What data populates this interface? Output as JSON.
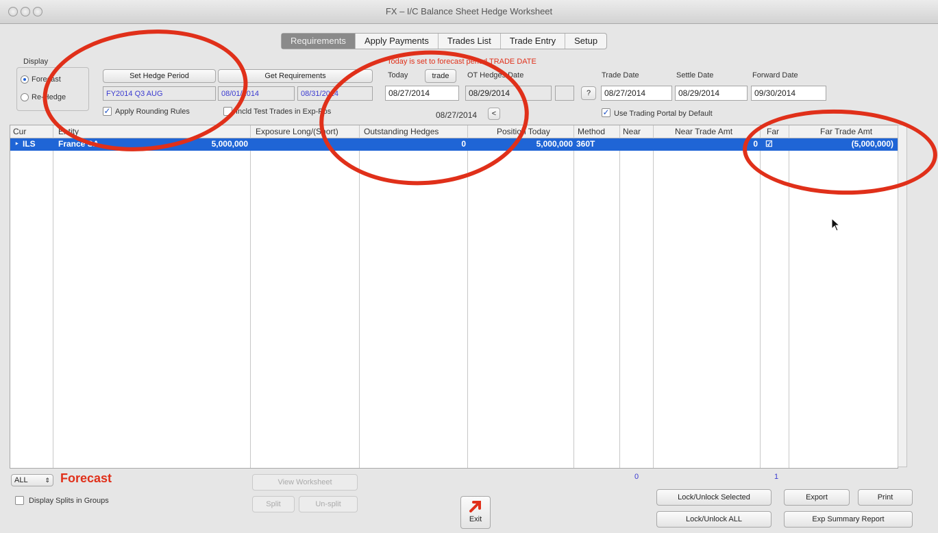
{
  "window": {
    "title": "FX – I/C Balance Sheet Hedge Worksheet"
  },
  "tabs": [
    "Requirements",
    "Apply Payments",
    "Trades List",
    "Trade Entry",
    "Setup"
  ],
  "warning": "Today is set to forecast period TRADE DATE",
  "display": {
    "label": "Display",
    "options": [
      "Forecast",
      "Re-Hedge"
    ],
    "selected": "Forecast"
  },
  "hedge": {
    "set_period_button": "Set Hedge Period",
    "get_requirements_button": "Get Requirements",
    "period": "FY2014 Q3 AUG",
    "start": "08/01/2014",
    "end": "08/31/2014",
    "apply_rounding_label": "Apply Rounding Rules",
    "incl_test_trades_label": "Incld Test Trades in Exp-Pos"
  },
  "dates": {
    "today_label": "Today",
    "trade_button": "trade",
    "today_value": "08/27/2014",
    "ot_hedges_label": "OT Hedges Date",
    "ot_hedges_value": "08/29/2014",
    "question_button": "?",
    "sub_date": "08/27/2014",
    "nav_prev": "<",
    "trade_date_label": "Trade Date",
    "trade_date_value": "08/27/2014",
    "settle_date_label": "Settle Date",
    "settle_date_value": "08/29/2014",
    "forward_date_label": "Forward Date",
    "forward_date_value": "09/30/2014",
    "use_portal_label": "Use Trading Portal by Default"
  },
  "table": {
    "columns": [
      "Cur",
      "Entity",
      "Exposure Long/(Short)",
      "Outstanding Hedges",
      "Position Today",
      "Method",
      "Near",
      "Near Trade Amt",
      "Far",
      "Far Trade Amt"
    ],
    "rows": [
      {
        "cur": "ILS",
        "entity": "France SA",
        "exposure": "5,000,000",
        "outstanding": "0",
        "position": "5,000,000",
        "method": "360T",
        "near": "",
        "near_amt": "0",
        "far": "☑",
        "far_amt": "(5,000,000)"
      }
    ],
    "near_count": "0",
    "far_count": "1"
  },
  "bottom": {
    "filter_value": "ALL",
    "mode_label": "Forecast",
    "display_splits_label": "Display Splits in Groups",
    "view_worksheet": "View Worksheet",
    "split": "Split",
    "unsplit": "Un-split",
    "exit": "Exit",
    "lock_selected": "Lock/Unlock Selected",
    "lock_all": "Lock/Unlock ALL",
    "export": "Export",
    "print": "Print",
    "exp_summary": "Exp Summary Report"
  },
  "colors": {
    "accent": "#1f65d6",
    "warning": "#e0301a",
    "circle": "#e0301a"
  }
}
